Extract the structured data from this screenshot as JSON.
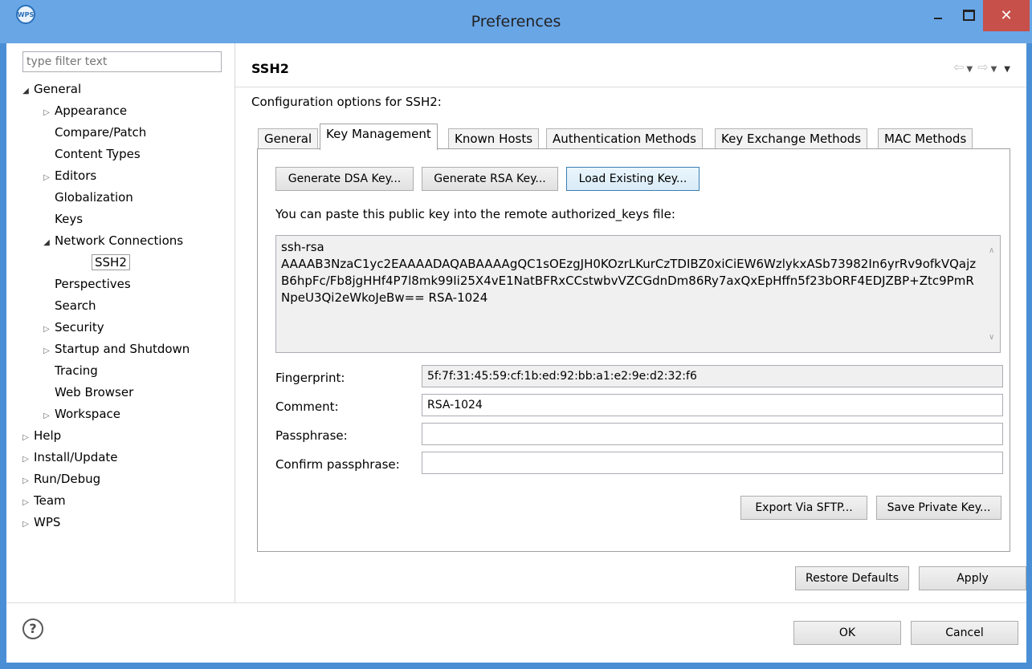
{
  "window": {
    "title": "Preferences",
    "close_glyph": "✕"
  },
  "left": {
    "filter_placeholder": "type filter text",
    "tree": [
      {
        "label": "General",
        "expanded": true
      },
      {
        "label": "Appearance"
      },
      {
        "label": "Compare/Patch"
      },
      {
        "label": "Content Types"
      },
      {
        "label": "Editors"
      },
      {
        "label": "Globalization"
      },
      {
        "label": "Keys"
      },
      {
        "label": "Network Connections",
        "expanded": true
      },
      {
        "label": "SSH2",
        "selected": true
      },
      {
        "label": "Perspectives"
      },
      {
        "label": "Search"
      },
      {
        "label": "Security"
      },
      {
        "label": "Startup and Shutdown"
      },
      {
        "label": "Tracing"
      },
      {
        "label": "Web Browser"
      },
      {
        "label": "Workspace"
      },
      {
        "label": "Help"
      },
      {
        "label": "Install/Update"
      },
      {
        "label": "Run/Debug"
      },
      {
        "label": "Team"
      },
      {
        "label": "WPS"
      }
    ]
  },
  "page": {
    "title": "SSH2",
    "description": "Configuration options for SSH2:",
    "tabs": [
      "General",
      "Key Management",
      "Known Hosts",
      "Authentication Methods",
      "Key Exchange Methods",
      "MAC Methods"
    ],
    "active_tab": "Key Management",
    "buttons": {
      "gen_dsa": "Generate DSA Key...",
      "gen_rsa": "Generate RSA Key...",
      "load_existing": "Load Existing Key..."
    },
    "paste_hint": "You can paste this public key into the remote authorized_keys file:",
    "public_key_line1": "ssh-rsa",
    "public_key_line2": "AAAAB3NzaC1yc2EAAAADAQABAAAAgQC1sOEzgJH0KOzrLKurCzTDIBZ0xiCiEW6WzlykxASb73982In6yrRv9ofkVQajzB6hpFc/Fb8jgHHf4P7l8mk99Ii25X4vE1NatBFRxCCstwbvVZCGdnDm86Ry7axQxEpHffn5f23bORF4EDJZBP+Ztc9PmRNpeU3Qi2eWkoJeBw== RSA-1024",
    "fields": {
      "fingerprint_label": "Fingerprint:",
      "fingerprint_value": "5f:7f:31:45:59:cf:1b:ed:92:bb:a1:e2:9e:d2:32:f6",
      "comment_label": "Comment:",
      "comment_value": "RSA-1024",
      "passphrase_label": "Passphrase:",
      "passphrase_value": "",
      "confirm_label": "Confirm passphrase:",
      "confirm_value": ""
    },
    "export_button": "Export Via SFTP...",
    "save_private_button": "Save Private Key...",
    "restore_defaults": "Restore Defaults",
    "apply": "Apply"
  },
  "footer": {
    "help_glyph": "?",
    "ok": "OK",
    "cancel": "Cancel"
  },
  "colors": {
    "title_bar": "#69a6e6",
    "close_button": "#c7504a",
    "focus_border": "#3c7fb1"
  },
  "icons": {
    "back": "⇦",
    "forward": "⇨",
    "dropdown": "▼",
    "tree_collapsed": "▷",
    "tree_expanded": "◢",
    "scroll_up": "∧",
    "scroll_down": "∨"
  }
}
